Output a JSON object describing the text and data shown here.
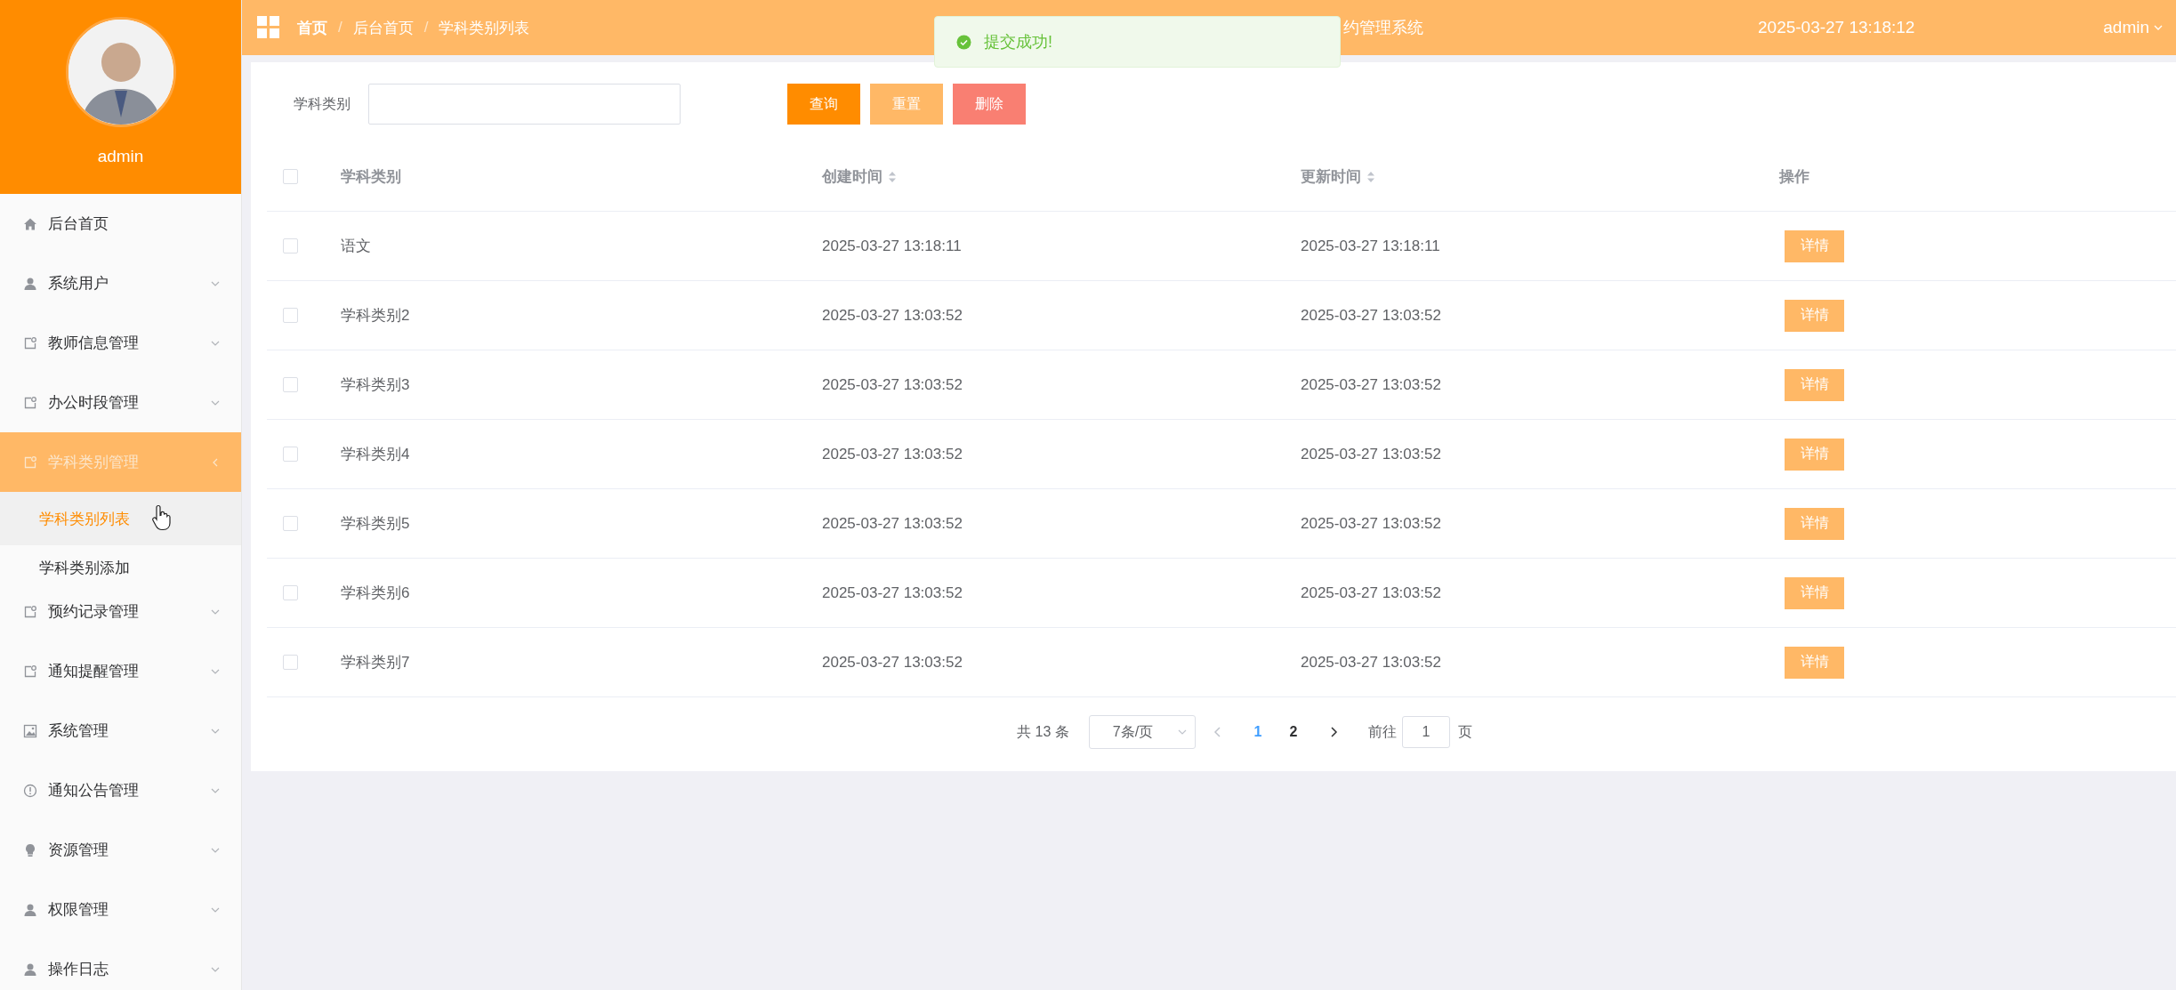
{
  "sidebar": {
    "user": "admin",
    "menu": [
      {
        "label": "后台首页",
        "kind": "link",
        "selected": false
      },
      {
        "label": "系统用户",
        "kind": "group",
        "expanded": false,
        "selected": false
      },
      {
        "label": "教师信息管理",
        "kind": "group",
        "expanded": false,
        "selected": false
      },
      {
        "label": "办公时段管理",
        "kind": "group",
        "expanded": false,
        "selected": false
      },
      {
        "label": "学科类别管理",
        "kind": "group",
        "expanded": true,
        "selected": true,
        "children": [
          {
            "label": "学科类别列表",
            "selected": true
          },
          {
            "label": "学科类别添加",
            "selected": false
          }
        ]
      },
      {
        "label": "预约记录管理",
        "kind": "group",
        "expanded": false,
        "selected": false
      },
      {
        "label": "通知提醒管理",
        "kind": "group",
        "expanded": false,
        "selected": false
      },
      {
        "label": "系统管理",
        "kind": "group",
        "expanded": false,
        "selected": false
      },
      {
        "label": "通知公告管理",
        "kind": "group",
        "expanded": false,
        "selected": false
      },
      {
        "label": "资源管理",
        "kind": "group",
        "expanded": false,
        "selected": false
      },
      {
        "label": "权限管理",
        "kind": "group",
        "expanded": false,
        "selected": false
      },
      {
        "label": "操作日志",
        "kind": "group",
        "expanded": false,
        "selected": false
      }
    ]
  },
  "header": {
    "breadcrumb": [
      "首页",
      "后台首页",
      "学科类别列表"
    ],
    "separator": "/",
    "title": "约管理系统",
    "datetime": "2025-03-27 13:18:12",
    "user": "admin"
  },
  "toast": {
    "message": "提交成功!"
  },
  "search": {
    "label": "学科类别"
  },
  "buttons": [
    {
      "label": "查询",
      "kind": "primary"
    },
    {
      "label": "重置",
      "kind": "secondary"
    },
    {
      "label": "删除",
      "kind": "danger"
    }
  ],
  "table": {
    "select_all": false,
    "columns": [
      {
        "label": "学科类别",
        "sortable": false
      },
      {
        "label": "创建时间",
        "sortable": true
      },
      {
        "label": "更新时间",
        "sortable": true
      },
      {
        "label": "操作",
        "sortable": false
      }
    ],
    "rows": [
      {
        "checked": false,
        "cells": [
          "语文",
          "2025-03-27 13:18:11",
          "2025-03-27 13:18:11"
        ],
        "action": "详情"
      },
      {
        "checked": false,
        "cells": [
          "学科类别2",
          "2025-03-27 13:03:52",
          "2025-03-27 13:03:52"
        ],
        "action": "详情"
      },
      {
        "checked": false,
        "cells": [
          "学科类别3",
          "2025-03-27 13:03:52",
          "2025-03-27 13:03:52"
        ],
        "action": "详情"
      },
      {
        "checked": false,
        "cells": [
          "学科类别4",
          "2025-03-27 13:03:52",
          "2025-03-27 13:03:52"
        ],
        "action": "详情"
      },
      {
        "checked": false,
        "cells": [
          "学科类别5",
          "2025-03-27 13:03:52",
          "2025-03-27 13:03:52"
        ],
        "action": "详情"
      },
      {
        "checked": false,
        "cells": [
          "学科类别6",
          "2025-03-27 13:03:52",
          "2025-03-27 13:03:52"
        ],
        "action": "详情"
      },
      {
        "checked": false,
        "cells": [
          "学科类别7",
          "2025-03-27 13:03:52",
          "2025-03-27 13:03:52"
        ],
        "action": "详情"
      }
    ]
  },
  "pagination": {
    "total": "共 13 条",
    "page_size": "7条/页",
    "pages": [
      {
        "label": "1",
        "selected": true
      },
      {
        "label": "2",
        "selected": false
      }
    ],
    "goto_label": "前往",
    "goto_value": "1",
    "goto_suffix": "页"
  }
}
